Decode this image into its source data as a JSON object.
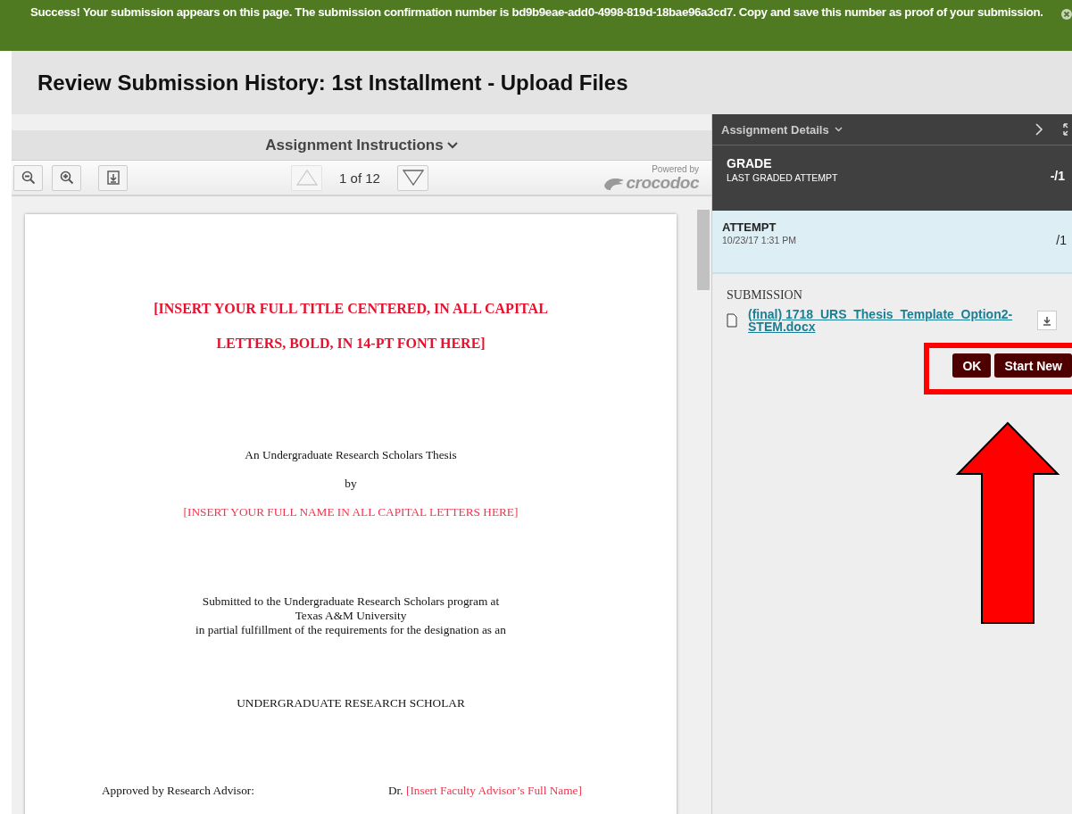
{
  "banner": {
    "text": "Success! Your submission appears on this page. The submission confirmation number is bd9b9eae-add0-4998-819d-18bae96a3cd7. Copy and save this number as proof of your submission."
  },
  "page_title": "Review Submission History: 1st Installment - Upload Files",
  "viewer": {
    "header": "Assignment Instructions",
    "page_indicator": "1 of 12",
    "prev_disabled": true,
    "next_disabled": false,
    "powered_by": "Powered by",
    "brand": "crocodoc",
    "document": [
      {
        "kind": "title",
        "lines": [
          "[INSERT YOUR FULL TITLE CENTERED, IN ALL CAPITAL",
          "LETTERS, BOLD, IN 14-PT FONT HERE]"
        ]
      },
      {
        "kind": "plain",
        "lines": [
          "An Undergraduate Research Scholars Thesis"
        ]
      },
      {
        "kind": "plain",
        "lines": [
          "by"
        ]
      },
      {
        "kind": "placeholder",
        "lines": [
          "[INSERT YOUR FULL NAME IN ALL CAPITAL LETTERS HERE]"
        ]
      },
      {
        "kind": "plain",
        "lines": [
          "Submitted to the Undergraduate Research Scholars program at",
          "Texas A&M University",
          "in partial fulfillment of the requirements for the designation as an"
        ]
      },
      {
        "kind": "plain",
        "lines": [
          "UNDERGRADUATE RESEARCH SCHOLAR"
        ]
      },
      {
        "kind": "signature",
        "label": "Approved by Research Advisor:",
        "prefix": "Dr.",
        "placeholder": "[Insert Faculty Advisor’s Full Name]"
      }
    ]
  },
  "details": {
    "header": "Assignment Details",
    "grade": {
      "label": "GRADE",
      "sublabel": "LAST GRADED ATTEMPT",
      "score": "-/1"
    },
    "attempt": {
      "label": "ATTEMPT",
      "date": "10/23/17 1:31 PM",
      "score": "/1"
    },
    "submission": {
      "label": "SUBMISSION",
      "file": "(final) 1718_URS_Thesis_Template_Option2-STEM.docx"
    },
    "buttons": [
      "OK",
      "Start New"
    ]
  }
}
